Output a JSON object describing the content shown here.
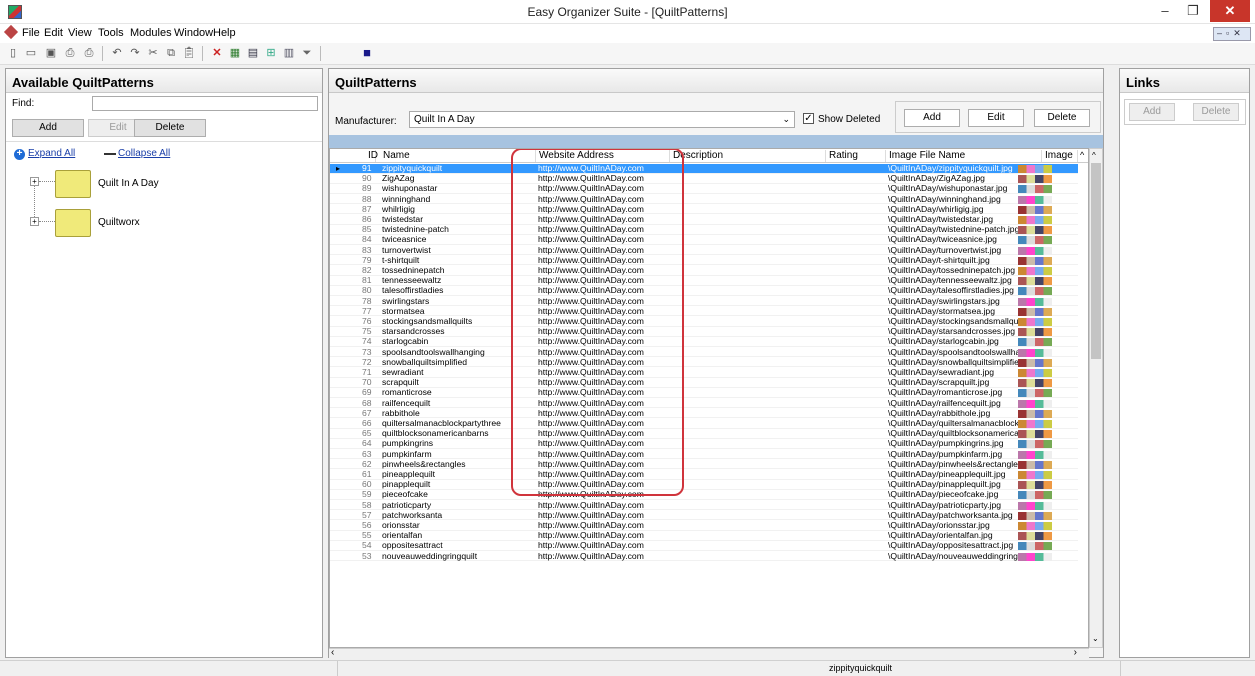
{
  "window": {
    "title": "Easy Organizer Suite - [QuiltPatterns]"
  },
  "menu": [
    "File",
    "Edit",
    "View",
    "Tools",
    "Modules",
    "Window",
    "Help"
  ],
  "left_panel": {
    "title": "Available QuiltPatterns",
    "find_label": "Find:",
    "find_value": "",
    "add_label": "Add",
    "edit_label": "Edit",
    "delete_label": "Delete",
    "expand_all": "Expand All",
    "collapse_all": "Collapse All",
    "tree": [
      "Quilt In A Day",
      "Quiltworx"
    ]
  },
  "center_panel": {
    "title": "QuiltPatterns",
    "manufacturer_label": "Manufacturer:",
    "manufacturer_value": "Quilt In A Day",
    "show_deleted_label": "Show Deleted",
    "show_deleted_checked": true,
    "add_label": "Add",
    "edit_label": "Edit",
    "delete_label": "Delete",
    "columns": [
      "ID",
      "Name",
      "Website Address",
      "Description",
      "Rating",
      "Image File Name",
      "Image"
    ],
    "rows": [
      {
        "id": "91",
        "name": "zippityquickquilt",
        "url": "http://www.QuiltInADay.com",
        "file": "\\QuiltInADay/zippityquickquilt.jpg"
      },
      {
        "id": "90",
        "name": "ZigAZag",
        "url": "http://www.QuiltInADay.com",
        "file": "\\QuiltInADay/ZigAZag.jpg"
      },
      {
        "id": "89",
        "name": "wishuponastar",
        "url": "http://www.QuiltInADay.com",
        "file": "\\QuiltInADay/wishuponastar.jpg"
      },
      {
        "id": "88",
        "name": "winninghand",
        "url": "http://www.QuiltInADay.com",
        "file": "\\QuiltInADay/winninghand.jpg"
      },
      {
        "id": "87",
        "name": "whilrligig",
        "url": "http://www.QuiltInADay.com",
        "file": "\\QuiltInADay/whirligig.jpg"
      },
      {
        "id": "86",
        "name": "twistedstar",
        "url": "http://www.QuiltInADay.com",
        "file": "\\QuiltInADay/twistedstar.jpg"
      },
      {
        "id": "85",
        "name": "twistednine-patch",
        "url": "http://www.QuiltInADay.com",
        "file": "\\QuiltInADay/twistednine-patch.jpg"
      },
      {
        "id": "84",
        "name": "twiceasnice",
        "url": "http://www.QuiltInADay.com",
        "file": "\\QuiltInADay/twiceasnice.jpg"
      },
      {
        "id": "83",
        "name": "turnovertwist",
        "url": "http://www.QuiltInADay.com",
        "file": "\\QuiltInADay/turnovertwist.jpg"
      },
      {
        "id": "79",
        "name": "t-shirtquilt",
        "url": "http://www.QuiltInADay.com",
        "file": "\\QuiltInADay/t-shirtquilt.jpg"
      },
      {
        "id": "82",
        "name": "tossedninepatch",
        "url": "http://www.QuiltInADay.com",
        "file": "\\QuiltInADay/tossedninepatch.jpg"
      },
      {
        "id": "81",
        "name": "tennesseewaltz",
        "url": "http://www.QuiltInADay.com",
        "file": "\\QuiltInADay/tennesseewaltz.jpg"
      },
      {
        "id": "80",
        "name": "talesoffirstladies",
        "url": "http://www.QuiltInADay.com",
        "file": "\\QuiltInADay/talesoffirstladies.jpg"
      },
      {
        "id": "78",
        "name": "swirlingstars",
        "url": "http://www.QuiltInADay.com",
        "file": "\\QuiltInADay/swirlingstars.jpg"
      },
      {
        "id": "77",
        "name": "stormatsea",
        "url": "http://www.QuiltInADay.com",
        "file": "\\QuiltInADay/stormatsea.jpg"
      },
      {
        "id": "76",
        "name": "stockingsandsmallquilts",
        "url": "http://www.QuiltInADay.com",
        "file": "\\QuiltInADay/stockingsandsmallquilts.jp"
      },
      {
        "id": "75",
        "name": "starsandcrosses",
        "url": "http://www.QuiltInADay.com",
        "file": "\\QuiltInADay/starsandcrosses.jpg"
      },
      {
        "id": "74",
        "name": "starlogcabin",
        "url": "http://www.QuiltInADay.com",
        "file": "\\QuiltInADay/starlogcabin.jpg"
      },
      {
        "id": "73",
        "name": "spoolsandtoolswallhanging",
        "url": "http://www.QuiltInADay.com",
        "file": "\\QuiltInADay/spoolsandtoolswallhangin"
      },
      {
        "id": "72",
        "name": "snowballquiltsimplified",
        "url": "http://www.QuiltInADay.com",
        "file": "\\QuiltInADay/snowballquiltsimplified.jpg"
      },
      {
        "id": "71",
        "name": "sewradiant",
        "url": "http://www.QuiltInADay.com",
        "file": "\\QuiltInADay/sewradiant.jpg"
      },
      {
        "id": "70",
        "name": "scrapquilt",
        "url": "http://www.QuiltInADay.com",
        "file": "\\QuiltInADay/scrapquilt.jpg"
      },
      {
        "id": "69",
        "name": "romanticrose",
        "url": "http://www.QuiltInADay.com",
        "file": "\\QuiltInADay/romanticrose.jpg"
      },
      {
        "id": "68",
        "name": "railfencequilt",
        "url": "http://www.QuiltInADay.com",
        "file": "\\QuiltInADay/railfencequilt.jpg"
      },
      {
        "id": "67",
        "name": "rabbithole",
        "url": "http://www.QuiltInADay.com",
        "file": "\\QuiltInADay/rabbithole.jpg"
      },
      {
        "id": "66",
        "name": "quiltersalmanacblockpartythree",
        "url": "http://www.QuiltInADay.com",
        "file": "\\QuiltInADay/quiltersalmanacblockpartyt"
      },
      {
        "id": "65",
        "name": "quiltblocksonamericanbarns",
        "url": "http://www.QuiltInADay.com",
        "file": "\\QuiltInADay/quiltblocksonamericanbar"
      },
      {
        "id": "64",
        "name": "pumpkingrins",
        "url": "http://www.QuiltInADay.com",
        "file": "\\QuiltInADay/pumpkingrins.jpg"
      },
      {
        "id": "63",
        "name": "pumpkinfarm",
        "url": "http://www.QuiltInADay.com",
        "file": "\\QuiltInADay/pumpkinfarm.jpg"
      },
      {
        "id": "62",
        "name": "pinwheels&rectangles",
        "url": "http://www.QuiltInADay.com",
        "file": "\\QuiltInADay/pinwheels&rectangles.jpg"
      },
      {
        "id": "61",
        "name": "pineapplequilt",
        "url": "http://www.QuiltInADay.com",
        "file": "\\QuiltInADay/pineapplequilt.jpg"
      },
      {
        "id": "60",
        "name": "pinapplequilt",
        "url": "http://www.QuiltInADay.com",
        "file": "\\QuiltInADay/pinapplequilt.jpg"
      },
      {
        "id": "59",
        "name": "pieceofcake",
        "url": "http://www.QuiltInADay.com",
        "file": "\\QuiltInADay/pieceofcake.jpg"
      },
      {
        "id": "58",
        "name": "patrioticparty",
        "url": "http://www.QuiltInADay.com",
        "file": "\\QuiltInADay/patrioticparty.jpg"
      },
      {
        "id": "57",
        "name": "patchworksanta",
        "url": "http://www.QuiltInADay.com",
        "file": "\\QuiltInADay/patchworksanta.jpg"
      },
      {
        "id": "56",
        "name": "orionsstar",
        "url": "http://www.QuiltInADay.com",
        "file": "\\QuiltInADay/orionsstar.jpg"
      },
      {
        "id": "55",
        "name": "orientalfan",
        "url": "http://www.QuiltInADay.com",
        "file": "\\QuiltInADay/orientalfan.jpg"
      },
      {
        "id": "54",
        "name": "oppositesattract",
        "url": "http://www.QuiltInADay.com",
        "file": "\\QuiltInADay/oppositesattract.jpg"
      },
      {
        "id": "53",
        "name": "nouveauweddingringquilt",
        "url": "http://www.QuiltInADay.com",
        "file": "\\QuiltInADay/nouveauweddingringquilt.j"
      }
    ]
  },
  "right_panel": {
    "title": "Links",
    "add_label": "Add",
    "delete_label": "Delete"
  },
  "status": {
    "text": "zippityquickquilt"
  },
  "colors": {
    "selection": "#3399ff",
    "highlight_box": "#d0343c",
    "grid_band": "#a7c3e0"
  }
}
